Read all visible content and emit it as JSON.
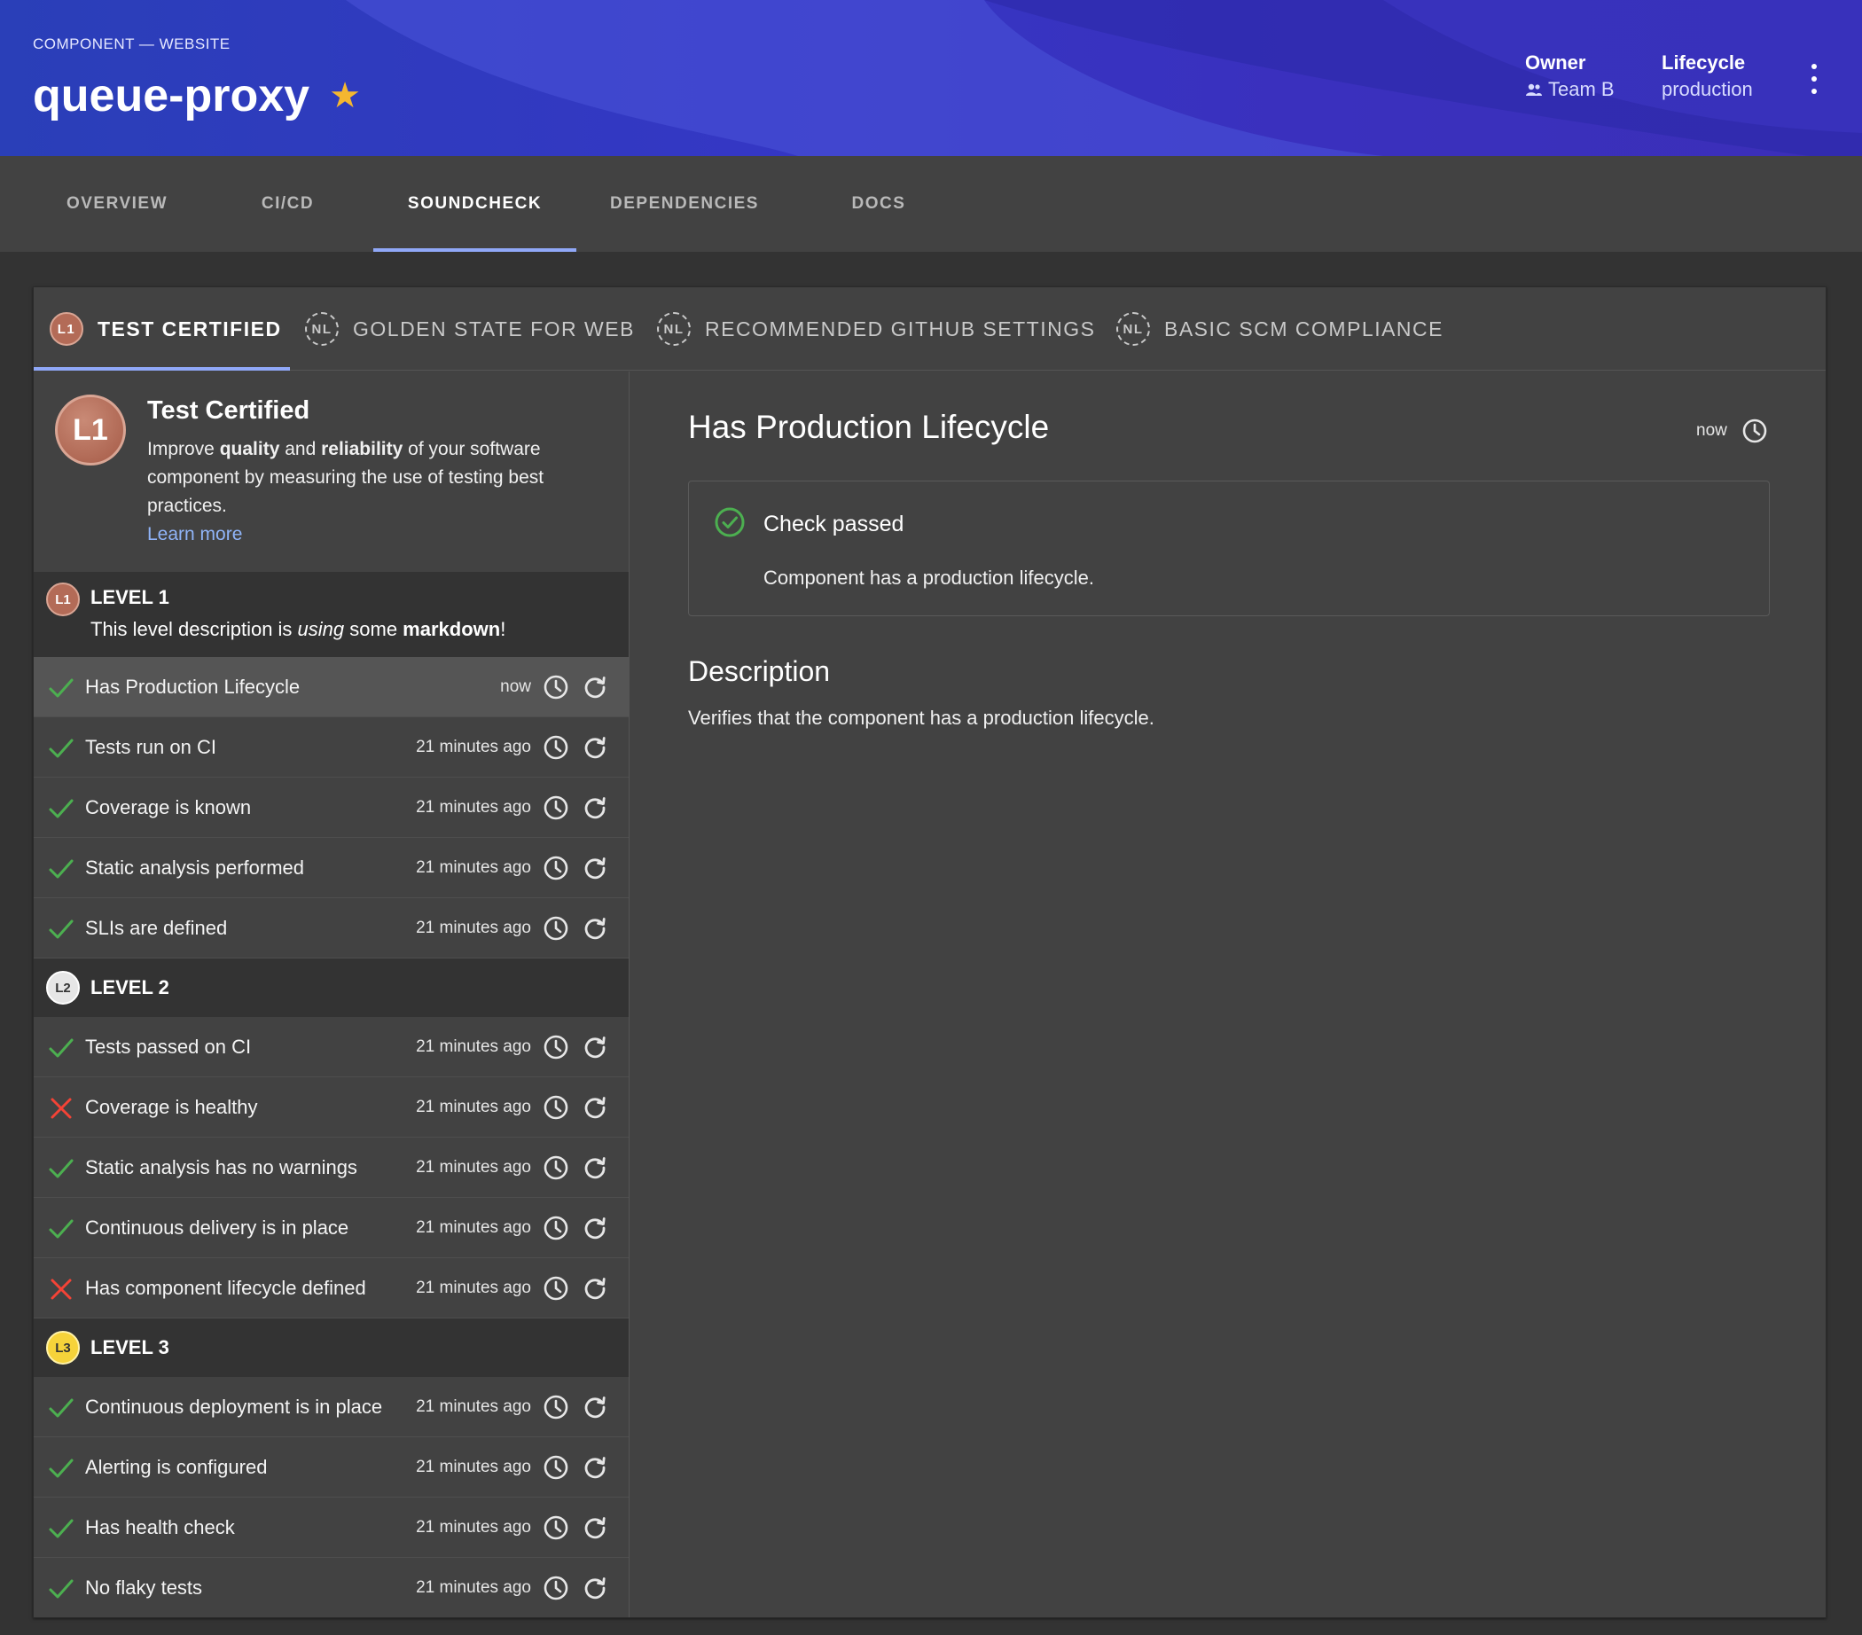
{
  "header": {
    "breadcrumb": "COMPONENT — WEBSITE",
    "title": "queue-proxy",
    "owner_label": "Owner",
    "owner_value": "Team B",
    "lifecycle_label": "Lifecycle",
    "lifecycle_value": "production"
  },
  "tabs": [
    {
      "label": "OVERVIEW",
      "active": false
    },
    {
      "label": "CI/CD",
      "active": false
    },
    {
      "label": "SOUNDCHECK",
      "active": true
    },
    {
      "label": "DEPENDENCIES",
      "active": false
    },
    {
      "label": "DOCS",
      "active": false
    }
  ],
  "subtabs": [
    {
      "badge": "L1",
      "label": "TEST CERTIFIED",
      "active": true
    },
    {
      "badge": "NL",
      "label": "GOLDEN STATE FOR WEB",
      "active": false
    },
    {
      "badge": "NL",
      "label": "RECOMMENDED GITHUB SETTINGS",
      "active": false
    },
    {
      "badge": "NL",
      "label": "BASIC SCM COMPLIANCE",
      "active": false
    }
  ],
  "intro": {
    "badge": "L1",
    "title": "Test Certified",
    "desc_1": "Improve ",
    "desc_bold_1": "quality",
    "desc_2": " and ",
    "desc_bold_2": "reliability",
    "desc_3": " of your software component by measuring the use of testing best practices.",
    "learn_more": "Learn more"
  },
  "levels": [
    {
      "badge": "L1",
      "name": "LEVEL 1",
      "desc_1": "This level description is ",
      "desc_italic": "using",
      "desc_2": " some ",
      "desc_bold": "markdown",
      "desc_3": "!"
    },
    {
      "badge": "L2",
      "name": "LEVEL 2"
    },
    {
      "badge": "L3",
      "name": "LEVEL 3"
    }
  ],
  "checks": [
    {
      "name": "Has Production Lifecycle",
      "time": "now",
      "status": "pass"
    },
    {
      "name": "Tests run on CI",
      "time": "21 minutes ago",
      "status": "pass"
    },
    {
      "name": "Coverage is known",
      "time": "21 minutes ago",
      "status": "pass"
    },
    {
      "name": "Static analysis performed",
      "time": "21 minutes ago",
      "status": "pass"
    },
    {
      "name": "SLIs are defined",
      "time": "21 minutes ago",
      "status": "pass"
    },
    {
      "name": "Tests passed on CI",
      "time": "21 minutes ago",
      "status": "pass"
    },
    {
      "name": "Coverage is healthy",
      "time": "21 minutes ago",
      "status": "fail"
    },
    {
      "name": "Static analysis has no warnings",
      "time": "21 minutes ago",
      "status": "pass"
    },
    {
      "name": "Continuous delivery is in place",
      "time": "21 minutes ago",
      "status": "pass"
    },
    {
      "name": "Has component lifecycle defined",
      "time": "21 minutes ago",
      "status": "fail"
    },
    {
      "name": "Continuous deployment is in place",
      "time": "21 minutes ago",
      "status": "pass"
    },
    {
      "name": "Alerting is configured",
      "time": "21 minutes ago",
      "status": "pass"
    },
    {
      "name": "Has health check",
      "time": "21 minutes ago",
      "status": "pass"
    },
    {
      "name": "No flaky tests",
      "time": "21 minutes ago",
      "status": "pass"
    }
  ],
  "detail": {
    "title": "Has Production Lifecycle",
    "time": "now",
    "result_title": "Check passed",
    "result_desc": "Component has a production lifecycle.",
    "desc_heading": "Description",
    "desc_text": "Verifies that the component has a production lifecycle."
  },
  "colors": {
    "accent": "#90a8f8",
    "pass": "#4caf50",
    "fail": "#f44336",
    "star": "#f4b730",
    "header": "#3437c4"
  }
}
